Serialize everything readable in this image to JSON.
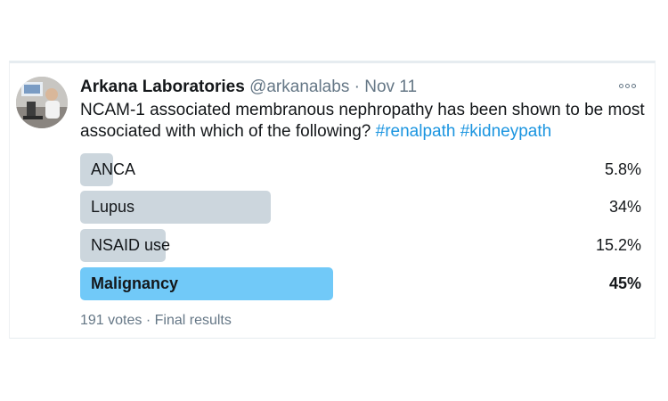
{
  "tweet": {
    "author_name": "Arkana Laboratories",
    "handle": "@arkanalabs",
    "separator": "·",
    "date": "Nov 11",
    "text": "NCAM-1 associated membranous nephropathy has been shown to be most associated with which of the following?",
    "hashtags": [
      "#renalpath",
      "#kidneypath"
    ],
    "more_icon": "ellipsis-icon"
  },
  "poll": {
    "options": [
      {
        "label": "ANCA",
        "percent_text": "5.8%",
        "percent": 5.8,
        "winner": false
      },
      {
        "label": "Lupus",
        "percent_text": "34%",
        "percent": 34,
        "winner": false
      },
      {
        "label": "NSAID use",
        "percent_text": "15.2%",
        "percent": 15.2,
        "winner": false
      },
      {
        "label": "Malignancy",
        "percent_text": "45%",
        "percent": 45,
        "winner": true
      }
    ],
    "votes": "191 votes",
    "separator": "·",
    "status": "Final results"
  },
  "colors": {
    "bar": "#ccd6dd",
    "winner_bar": "#71c9f8",
    "hashtag": "#1b95e0",
    "muted": "#657786"
  }
}
